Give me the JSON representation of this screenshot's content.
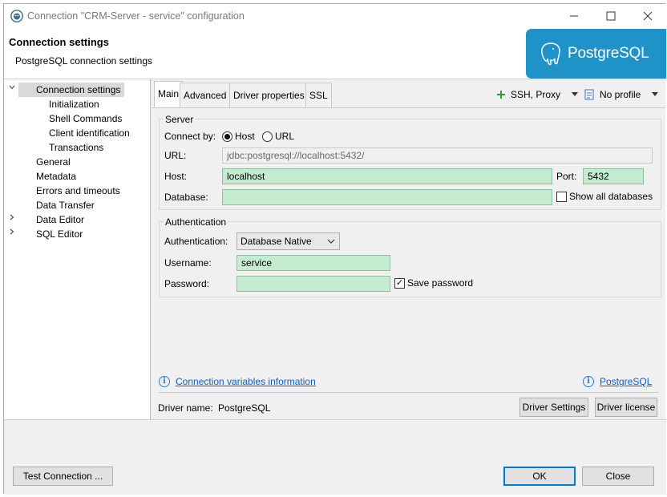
{
  "window": {
    "title": "Connection \"CRM-Server - service\" configuration",
    "buttons": {
      "minimize": "–",
      "maximize": "☐",
      "close": "✕"
    }
  },
  "header": {
    "title": "Connection settings",
    "subtitle": "PostgreSQL connection settings",
    "logo_text": "PostgreSQL",
    "logo_color": "#1f93c8"
  },
  "nav": {
    "items": [
      {
        "label": "Connection settings",
        "expanded": true,
        "selected": true
      },
      {
        "label": "Initialization"
      },
      {
        "label": "Shell Commands"
      },
      {
        "label": "Client identification"
      },
      {
        "label": "Transactions"
      },
      {
        "label": "General"
      },
      {
        "label": "Metadata"
      },
      {
        "label": "Errors and timeouts"
      },
      {
        "label": "Data Transfer"
      },
      {
        "label": "Data Editor",
        "collapsed": true
      },
      {
        "label": "SQL Editor",
        "collapsed": true
      }
    ]
  },
  "tabs": [
    {
      "label": "Main",
      "active": true
    },
    {
      "label": "Advanced"
    },
    {
      "label": "Driver properties"
    },
    {
      "label": "SSL"
    }
  ],
  "toolbar": {
    "ssh_proxy": "SSH, Proxy",
    "profile": "No profile"
  },
  "server": {
    "legend": "Server",
    "connect_by_label": "Connect by:",
    "connect_by_options": [
      "Host",
      "URL"
    ],
    "connect_by_selected": "Host",
    "url_label": "URL:",
    "url_value": "jdbc:postgresql://localhost:5432/",
    "host_label": "Host:",
    "host_value": "localhost",
    "port_label": "Port:",
    "port_value": "5432",
    "database_label": "Database:",
    "database_value": "",
    "show_all_label": "Show all databases",
    "show_all_checked": false
  },
  "auth": {
    "legend": "Authentication",
    "auth_label": "Authentication:",
    "auth_value": "Database Native",
    "username_label": "Username:",
    "username_value": "service",
    "password_label": "Password:",
    "password_value": "",
    "save_password_label": "Save password",
    "save_password_checked": true
  },
  "links": {
    "variables": "Connection variables information",
    "postgresql": "PostgreSQL"
  },
  "driver": {
    "name_label": "Driver name:",
    "name_value": "PostgreSQL",
    "settings_button": "Driver Settings",
    "license_button": "Driver license"
  },
  "footer": {
    "test_button": "Test Connection ...",
    "ok_button": "OK",
    "close_button": "Close"
  },
  "colors": {
    "field_green": "#c5ebd0",
    "link_blue": "#0b5fc6",
    "default_button_border": "#0078d7"
  }
}
